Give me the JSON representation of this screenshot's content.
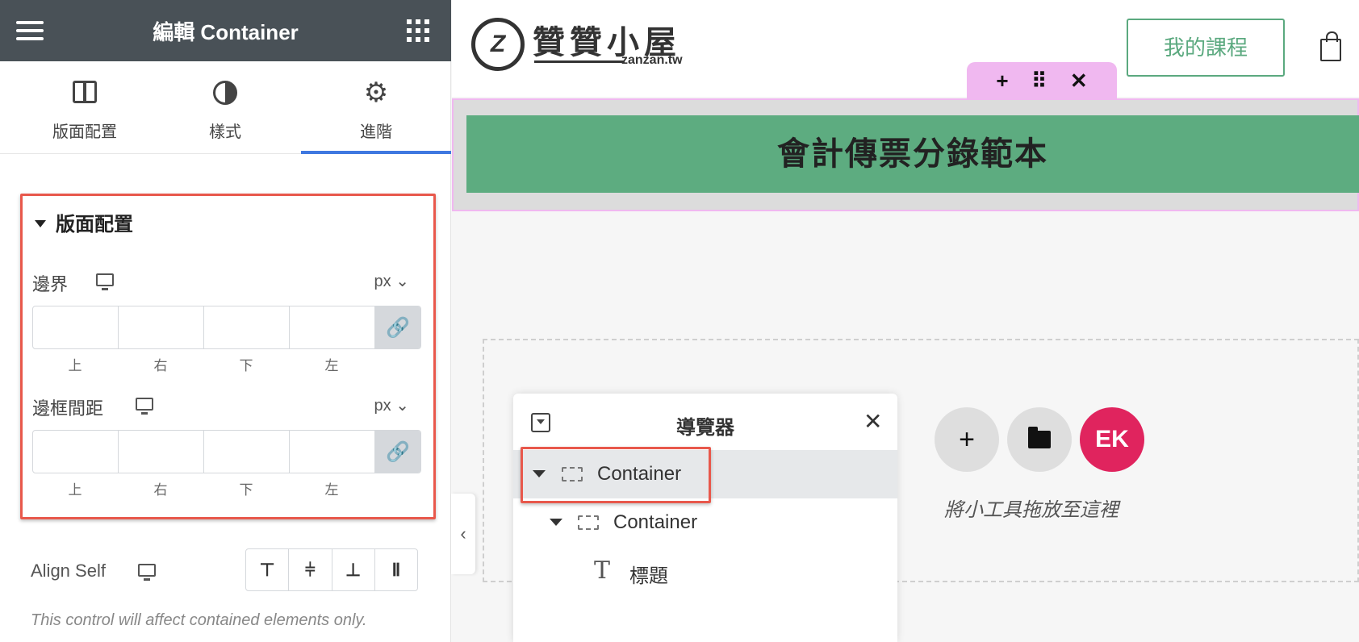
{
  "panel": {
    "title": "編輯 Container",
    "tabs": [
      {
        "label": "版面配置",
        "icon": "layout-icon"
      },
      {
        "label": "樣式",
        "icon": "style-icon"
      },
      {
        "label": "進階",
        "icon": "gear-icon",
        "active": true
      }
    ],
    "section_title": "版面配置",
    "margin": {
      "label": "邊界",
      "unit": "px",
      "sides": [
        "上",
        "右",
        "下",
        "左"
      ]
    },
    "padding": {
      "label": "邊框間距",
      "unit": "px",
      "sides": [
        "上",
        "右",
        "下",
        "左"
      ]
    },
    "align_self": {
      "label": "Align Self"
    },
    "note": "This control will affect contained elements only."
  },
  "site": {
    "logo_text": "贊贊小屋",
    "logo_sub": "zanzan.tw",
    "course_button": "我的課程"
  },
  "hero": {
    "title": "會計傳票分錄範本"
  },
  "dropzone": {
    "text": "將小工具拖放至這裡"
  },
  "navigator": {
    "title": "導覽器",
    "items": [
      {
        "label": "Container",
        "level": 0,
        "selected": true
      },
      {
        "label": "Container",
        "level": 1
      },
      {
        "label": "標題",
        "level": 2
      }
    ]
  },
  "colors": {
    "header_bg": "#495157",
    "accent_blue": "#3f78e0",
    "highlight_red": "#e8584c",
    "brand_green": "#5dac80",
    "handle_pink": "#f0b8f0",
    "elementor_pink": "#e0245e"
  }
}
